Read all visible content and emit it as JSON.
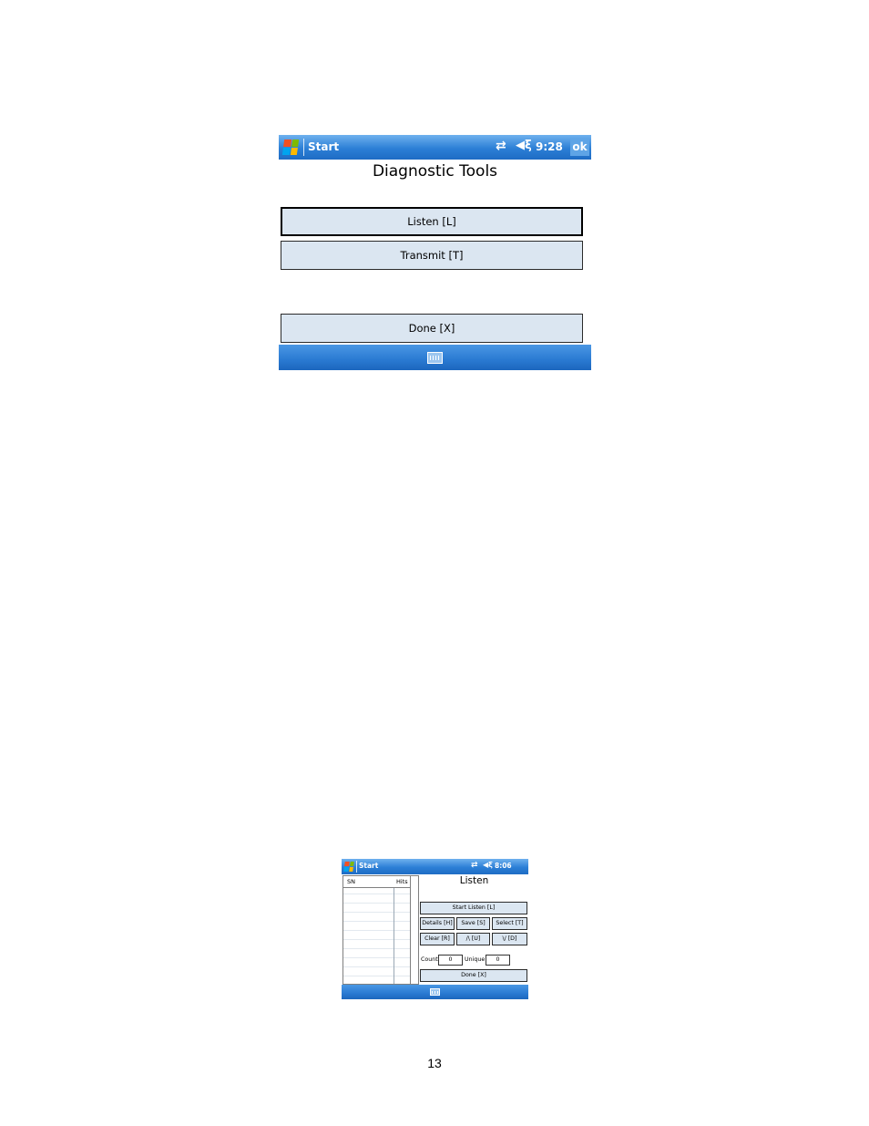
{
  "screen1": {
    "taskbar": {
      "start": "Start",
      "time": "9:28",
      "ok": "ok",
      "conn_icon": "⇄",
      "vol_icon": "◀ξ"
    },
    "title": "Diagnostic Tools",
    "buttons": {
      "listen": "Listen [L]",
      "transmit": "Transmit [T]",
      "done": "Done [X]"
    }
  },
  "screen2": {
    "taskbar": {
      "start": "Start",
      "time": "8:06",
      "conn_icon": "⇄",
      "vol_icon": "◀ξ"
    },
    "list": {
      "col_sn": "SN",
      "col_hits": "Hits"
    },
    "title": "Listen",
    "buttons": {
      "start_listen": "Start Listen [L]",
      "details": "Details [H]",
      "save": "Save [S]",
      "select": "Select [T]",
      "clear": "Clear [R]",
      "up": "/\\     [U]",
      "down": "\\/     [D]",
      "done": "Done [X]"
    },
    "count_label": "Count",
    "count_value": "0",
    "unique_label": "Unique",
    "unique_value": "0"
  },
  "page_number": "13"
}
